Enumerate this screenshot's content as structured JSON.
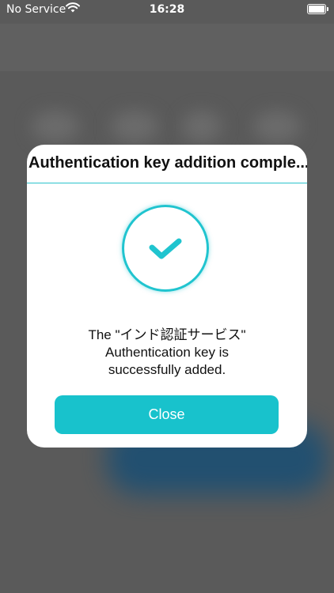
{
  "status_bar": {
    "carrier": "No Service",
    "time": "16:28",
    "wifi_icon": "wifi-icon",
    "battery_icon": "battery-full-icon"
  },
  "dialog": {
    "title": "Authentication key addition comple...",
    "icon": "checkmark-circle-icon",
    "message_line1": "The \"インド認証サービス\"",
    "message_line2": "Authentication key is",
    "message_line3": "successfully added.",
    "close_label": "Close",
    "accent_color": "#18c2cc"
  }
}
